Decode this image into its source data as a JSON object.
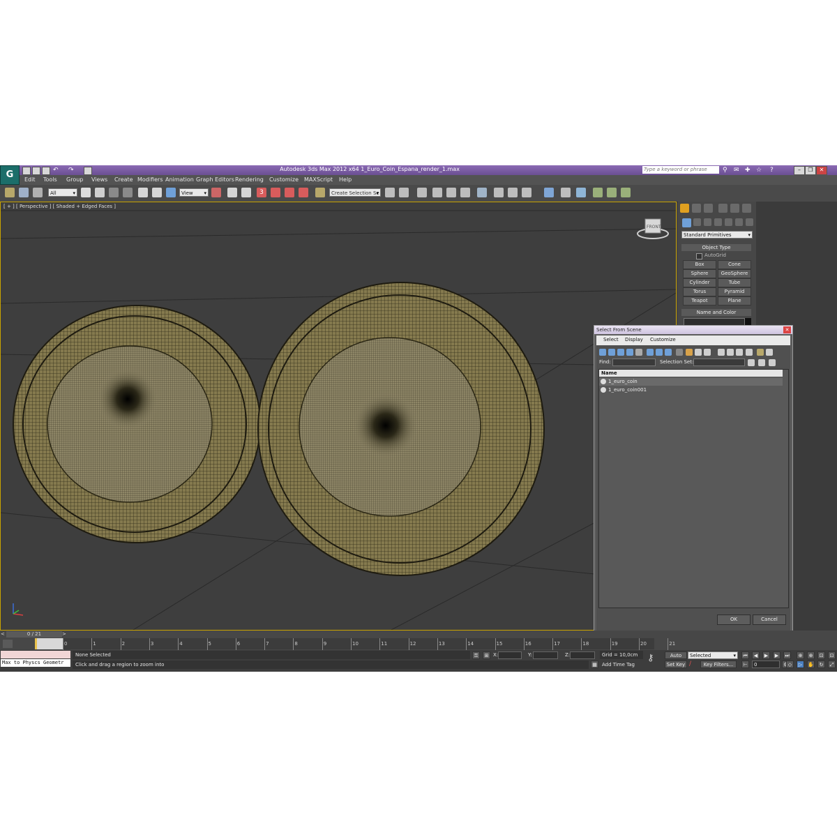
{
  "window": {
    "title": "Autodesk 3ds Max  2012 x64     1_Euro_Coin_Espana_render_1.max",
    "search_placeholder": "Type a keyword or phrase",
    "logo": "G"
  },
  "menu": [
    "Edit",
    "Tools",
    "Group",
    "Views",
    "Create",
    "Modifiers",
    "Animation",
    "Graph Editors",
    "Rendering",
    "Customize",
    "MAXScript",
    "Help"
  ],
  "toolbar": {
    "selection_filter": "All",
    "ref_coord": "View",
    "snap_label": "3",
    "named_selection": "Create Selection Se"
  },
  "viewport": {
    "label": "[ + ] [ Perspective ] [ Shaded + Edged Faces ]",
    "viewcube": "FRONT"
  },
  "command_panel": {
    "category": "Standard Primitives",
    "object_type_title": "Object Type",
    "autogrid": "AutoGrid",
    "primitives": [
      "Box",
      "Cone",
      "Sphere",
      "GeoSphere",
      "Cylinder",
      "Tube",
      "Torus",
      "Pyramid",
      "Teapot",
      "Plane"
    ],
    "name_color_title": "Name and Color"
  },
  "dialog": {
    "title": "Select From Scene",
    "menu": [
      "Select",
      "Display",
      "Customize"
    ],
    "find_label": "Find:",
    "selection_set_label": "Selection Set:",
    "column_name": "Name",
    "items": [
      "1_euro_coin",
      "1_euro_coin001"
    ],
    "ok": "OK",
    "cancel": "Cancel"
  },
  "timeline": {
    "frame_slider": "0 / 21",
    "ticks": [
      "0",
      "1",
      "2",
      "3",
      "4",
      "5",
      "6",
      "7",
      "8",
      "9",
      "10",
      "11",
      "12",
      "13",
      "14",
      "15",
      "16",
      "17",
      "18",
      "19",
      "20",
      "21"
    ]
  },
  "status": {
    "maxscript_line": "Max to Physcs Geometr",
    "selection": "None Selected",
    "prompt": "Click and drag a region to zoom into",
    "x_label": "X:",
    "y_label": "Y:",
    "z_label": "Z:",
    "grid": "Grid = 10,0cm",
    "add_time_tag": "Add Time Tag",
    "auto_key": "Auto Key",
    "set_key": "Set Key",
    "key_mode": "Selected",
    "key_filters": "Key Filters...",
    "current_frame": "0"
  },
  "colors": {
    "title_bar": "#7a5ca3",
    "viewport_bg": "#3e3e3e",
    "active_viewport_border": "#c9a300",
    "coin_wire": "#857a4e"
  }
}
